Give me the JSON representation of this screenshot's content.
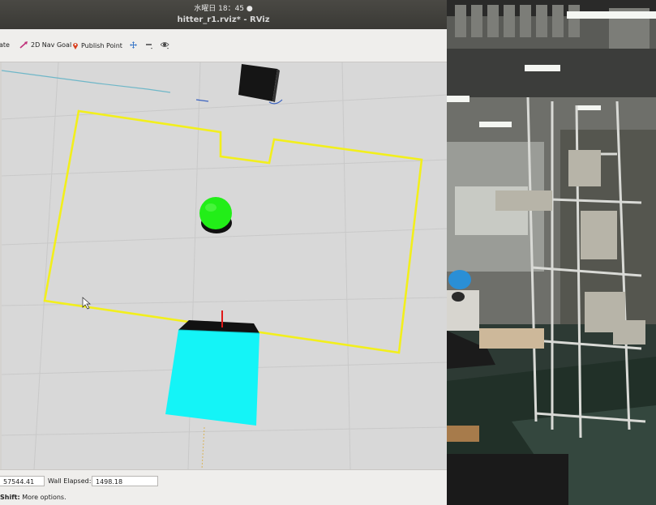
{
  "window": {
    "clock": "水曜日 18：45 ●",
    "title": "hitter_r1.rviz* - RViz"
  },
  "toolbar": {
    "tools": [
      {
        "label": "ate",
        "icon": "interact-icon"
      },
      {
        "label": "2D Nav Goal",
        "icon": "nav-goal-arrow-icon"
      },
      {
        "label": "Publish Point",
        "icon": "map-pin-icon"
      }
    ],
    "extra_icons": [
      "move-camera-icon",
      "minus-icon",
      "eye-icon"
    ]
  },
  "status": {
    "ros_time_value": "57544.41",
    "wall_elapsed_label": "Wall Elapsed:",
    "wall_elapsed_value": "1498.18",
    "hint_key": "Shift:",
    "hint_text": " More options."
  },
  "colors": {
    "boundary": "#f2ef1c",
    "target_sphere": "#22ee18",
    "robot_cube": "#14f4f7",
    "obstacle_cube": "#1a1a1a",
    "heading_arrow": "#e01818"
  }
}
